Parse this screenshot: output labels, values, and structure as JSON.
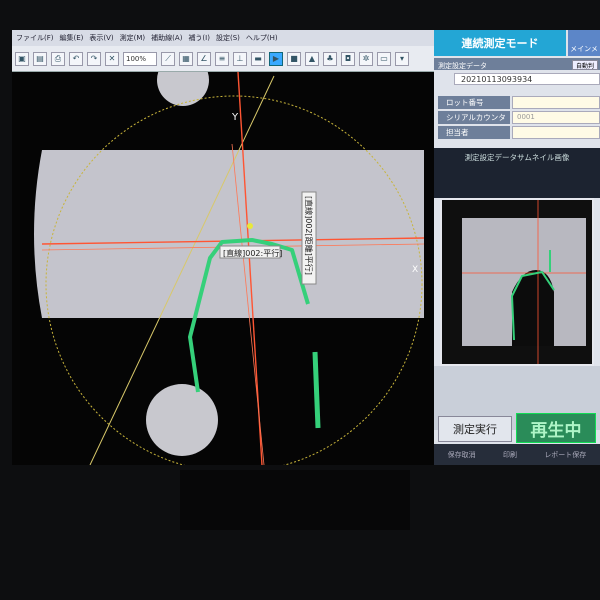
{
  "menu": [
    "ファイル(F)",
    "編集(E)",
    "表示(V)",
    "測定(M)",
    "補助線(A)",
    "補う(I)",
    "設定(S)",
    "ヘルプ(H)"
  ],
  "toolbar": {
    "zoom": "100%"
  },
  "viewer": {
    "axis_x_label": "X",
    "axis_y_label": "Y",
    "annotation_1": "[直線]002:平行]",
    "annotation_2": "[直線]002[距離]平行]"
  },
  "panel": {
    "mode_title": "連続測定モード",
    "menu_button": "メインメ",
    "settings_label": "測定設定データ",
    "auto_button": "自動判",
    "setting_id": "20210113093934",
    "fields": [
      {
        "label": "ロット番号",
        "value": ""
      },
      {
        "label": "シリアルカウンタ",
        "value": "0001"
      },
      {
        "label": "担当者",
        "value": ""
      }
    ],
    "thumb_title": "測定設定データサムネイル画像",
    "run_button": "測定実行",
    "playing": "再生中",
    "bottom_buttons": [
      "保存取消",
      "印刷",
      "レポート保存"
    ]
  },
  "colors": {
    "accent": "#23a6d5",
    "playing_bg": "#2a8c59",
    "edge_green": "#35d07a",
    "axis_red": "#ff5533"
  }
}
